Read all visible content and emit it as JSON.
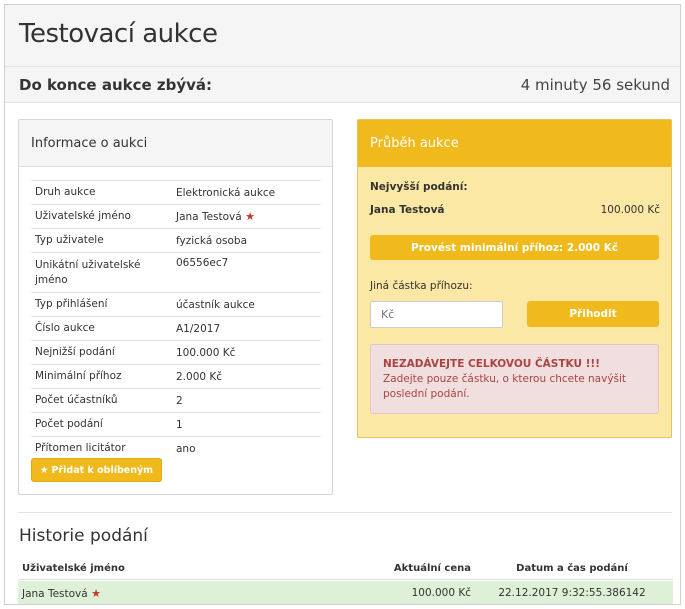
{
  "page": {
    "title": "Testovací aukce"
  },
  "countdown": {
    "label": "Do konce aukce zbývá:",
    "value": "4 minuty 56 sekund"
  },
  "info": {
    "heading": "Informace o aukci",
    "rows": [
      {
        "key": "Druh aukce",
        "value": "Elektronická aukce"
      },
      {
        "key": "Uživatelské jméno",
        "value": "Jana Testová"
      },
      {
        "key": "Typ uživatele",
        "value": "fyzická osoba"
      },
      {
        "key": "Unikátní uživatelské jméno",
        "value": "06556ec7"
      },
      {
        "key": "Typ přihlášení",
        "value": "účastník aukce"
      },
      {
        "key": "Číslo aukce",
        "value": "A1/2017"
      },
      {
        "key": "Nejnižší podání",
        "value": "100.000 Kč"
      },
      {
        "key": "Minimální příhoz",
        "value": "2.000 Kč"
      },
      {
        "key": "Počet účastníků",
        "value": "2"
      },
      {
        "key": "Počet podání",
        "value": "1"
      },
      {
        "key": "Přítomen licitátor",
        "value": "ano"
      }
    ],
    "favorite_label": "Přidat k oblíbeným"
  },
  "bidding": {
    "heading": "Průběh aukce",
    "highest_label": "Nejvyšší podání:",
    "highest_name": "Jana Testová",
    "highest_amount": "100.000 Kč",
    "min_bid_label": "Provést minimální příhoz: 2.000 Kč",
    "other_label": "Jiná částka příhozu:",
    "input_placeholder": "Kč",
    "bid_button": "Přihodit",
    "alert_title": "NEZADÁVEJTE CELKOVOU ČÁSTKU !!!",
    "alert_text": "Zadejte pouze částku, o kterou chcete navýšit poslední podání."
  },
  "history": {
    "title": "Historie podání",
    "columns": [
      "Uživatelské jméno",
      "Aktuální cena",
      "Datum a čas podání"
    ],
    "rows": [
      {
        "user": "Jana Testová",
        "price": "100.000 Kč",
        "datetime": "22.12.2017 9:32:55.386142"
      }
    ]
  },
  "colors": {
    "accent": "#f0b91c",
    "panel_bg": "#fbe8a4",
    "alert_bg": "#f1dede",
    "alert_text": "#a94442",
    "row_highlight": "#dff0d8"
  },
  "icons": {
    "favorite_star": "star-icon"
  }
}
